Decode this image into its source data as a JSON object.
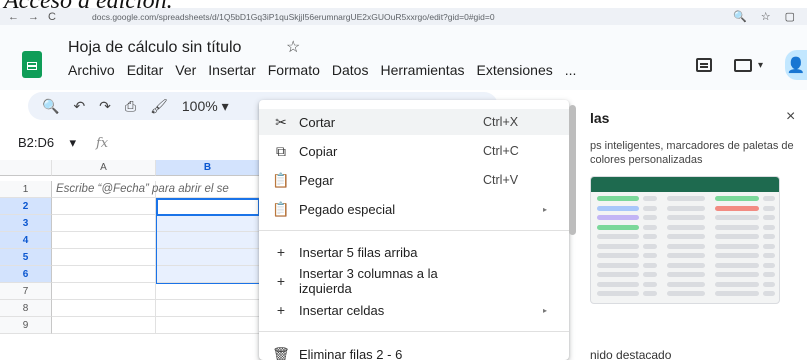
{
  "caption": "Acceso a edición.",
  "browser": {
    "url": "docs.google.com/spreadsheets/d/1Q5bD1Gq3iP1quSkjjI56erumnargUE2xGUOuR5xxrgo/edit?gid=0#gid=0",
    "nav_back": "←",
    "nav_forward": "→",
    "nav_reload": "C",
    "right_icons": [
      "🔍",
      "☆",
      "▢"
    ]
  },
  "header": {
    "doc_title": "Hoja de cálculo sin título",
    "star": "☆",
    "menus": [
      "Archivo",
      "Editar",
      "Ver",
      "Insertar",
      "Formato",
      "Datos",
      "Herramientas",
      "Extensiones",
      "..."
    ],
    "meet_caret": "▾",
    "share_icon": "👤"
  },
  "toolbar": {
    "search": "🔍",
    "undo": "↶",
    "redo": "↷",
    "print": "⎙",
    "paint": "🖌",
    "zoom": "100%",
    "zoom_caret": "▾"
  },
  "formula_bar": {
    "name_box": "B2:D6",
    "name_caret": "▾",
    "fx": "fx"
  },
  "grid": {
    "columns": [
      "A",
      "B"
    ],
    "rows": [
      "1",
      "2",
      "3",
      "4",
      "5",
      "6",
      "7",
      "8",
      "9"
    ],
    "selected_rows": [
      "2",
      "3",
      "4",
      "5",
      "6"
    ],
    "hint": "Escribe “@Fecha” para abrir el se"
  },
  "side_panel": {
    "title": "las",
    "close": "×",
    "description": "ps inteligentes, marcadores de paletas de colores personalizadas",
    "footer": "nido destacado"
  },
  "context_menu": {
    "items": [
      {
        "icon": "✂",
        "label": "Cortar",
        "shortcut": "Ctrl+X",
        "arrow": ""
      },
      {
        "icon": "⧉",
        "label": "Copiar",
        "shortcut": "Ctrl+C",
        "arrow": ""
      },
      {
        "icon": "📋",
        "label": "Pegar",
        "shortcut": "Ctrl+V",
        "arrow": ""
      },
      {
        "icon": "📋",
        "label": "Pegado especial",
        "shortcut": "",
        "arrow": "▸"
      },
      {
        "icon": "+",
        "label": "Insertar 5 filas arriba",
        "shortcut": "",
        "arrow": ""
      },
      {
        "icon": "+",
        "label": "Insertar 3 columnas a la izquierda",
        "shortcut": "",
        "arrow": ""
      },
      {
        "icon": "+",
        "label": "Insertar celdas",
        "shortcut": "",
        "arrow": "▸"
      },
      {
        "icon": "🗑",
        "label": "Eliminar filas 2 - 6",
        "shortcut": "",
        "arrow": ""
      }
    ]
  },
  "colors": {
    "selection": "#1a73e8",
    "selection_fill": "#e8f0fe",
    "sheets_green": "#0f9d58",
    "thumb_header": "#1e6a4f",
    "pill_green": "#7bd89a",
    "pill_blue": "#a8c7fa",
    "pill_purple": "#c3b5f5",
    "pill_red": "#f28b82",
    "pill_gray": "#dadce0"
  }
}
